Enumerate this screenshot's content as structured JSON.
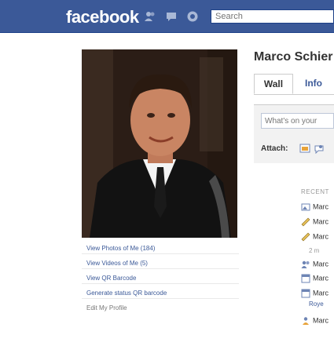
{
  "header": {
    "logo": "facebook",
    "search_placeholder": "Search"
  },
  "left_column": {
    "links": [
      "View Photos of Me (184)",
      "View Videos of Me (5)",
      "View QR Barcode",
      "Generate status QR barcode",
      "Edit My Profile"
    ]
  },
  "profile": {
    "name": "Marco Schier"
  },
  "tabs": [
    {
      "label": "Wall"
    },
    {
      "label": "Info"
    }
  ],
  "composer": {
    "status_placeholder": "What's on your",
    "attach_label": "Attach:"
  },
  "feed": {
    "heading": "RECENT",
    "items": [
      {
        "icon": "photo-icon",
        "text": "Marc"
      },
      {
        "icon": "wall-post-icon",
        "text": "Marc"
      },
      {
        "icon": "wall-post-icon",
        "text": "Marc"
      },
      {
        "icon": "friends-icon",
        "text": "Marc"
      },
      {
        "icon": "event-icon",
        "text": "Marc"
      },
      {
        "icon": "event-icon",
        "text": "Marc"
      },
      {
        "icon": "group-icon",
        "text": "Marc"
      }
    ],
    "meta": [
      "2 m",
      "Roye"
    ]
  }
}
